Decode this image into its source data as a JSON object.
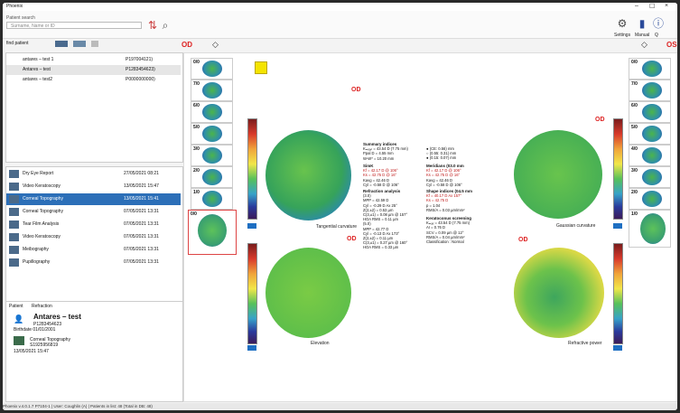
{
  "window": {
    "title": "Phoenix",
    "minimize": "–",
    "maximize": "☐",
    "close": "×"
  },
  "search": {
    "label": "Patient search",
    "placeholder": "Surname, Name or ID"
  },
  "toolbar_right": {
    "settings": "Settings",
    "manual": "Manual",
    "overflow": "Q"
  },
  "toolbar_left": {
    "find_patient": "find patient"
  },
  "patients": [
    {
      "name": "antares – test 1",
      "id": "P197004121)"
    },
    {
      "name": "Antares – test",
      "id": "P1283454623)"
    },
    {
      "name": "antares – test2",
      "id": "P0000000000)"
    }
  ],
  "exams": [
    {
      "name": "Dry Eye Report",
      "date": "27/05/2021 08:21"
    },
    {
      "name": "Video Keratoscopy",
      "date": "13/05/2021 15:47"
    },
    {
      "name": "Corneal Topography",
      "date": "13/05/2021 15:41"
    },
    {
      "name": "Corneal Topography",
      "date": "07/05/2021 13:31"
    },
    {
      "name": "Tear Film Analysis",
      "date": "07/05/2021 13:31"
    },
    {
      "name": "Video Keratoscopy",
      "date": "07/05/2021 13:31"
    },
    {
      "name": "Meibography",
      "date": "07/05/2021 13:31"
    },
    {
      "name": "Pupillography",
      "date": "07/05/2021 13:31"
    }
  ],
  "patient_tabs": {
    "patient": "Patient",
    "refraction": "Refraction"
  },
  "patient_info": {
    "name": "Antares – test",
    "id": "P1283454623",
    "birthdate": "Birthdate 01/01/2001",
    "exam_title": "Corneal Topography",
    "exam_id": "S1925956819",
    "exam_date": "13/05/2021 15:47"
  },
  "eye": {
    "left": "OD",
    "right": "OS"
  },
  "thumbs_left": [
    "0/0",
    "7/0",
    "6/0",
    "5/0",
    "3/0",
    "2/0",
    "1/0",
    "0/0"
  ],
  "thumbs_right": [
    "0/0",
    "7/0",
    "6/0",
    "5/0",
    "4/0",
    "3/0",
    "2/0",
    "1/0"
  ],
  "maps": {
    "tangential": "Tangential curvature",
    "gaussian": "Gaussian curvature",
    "elevation": "Elevation",
    "refractive": "Refractive power"
  },
  "summary": {
    "title": "Summary indices",
    "l1": "Kₘₑₐₙ = 43.54 D (7.75 mm)",
    "l2": "Ppal D = 4.55 mm",
    "l3": "W-W* = 10.20 mm",
    "r1": "● (CE: 0.56) mm",
    "r2": "○ (0.55: 0.31) mm",
    "r3": "● (0.15: 0.07) mm"
  },
  "simk": {
    "title": "SimK",
    "l1": "Kf = 42.17 D @ 106°",
    "l2": "Ks = 42.75 D @ 16°",
    "l3": "Kavg = 42.46 D",
    "l4": "Cyl = -0.58 D @ 106°"
  },
  "meridians": {
    "title": "Meridians (03.0 mm",
    "l1": "Kf = 42.17 D @ 106°",
    "l2": "Ks = 42.75 D @ 16°",
    "l3": "Kavg = 42.46 D",
    "l4": "Cyl = -0.58 D @ 106°"
  },
  "refraction": {
    "title": "Refraction analysis",
    "s1": "(3.0)",
    "l1": "MPP = 42.59 D",
    "l2": "Cyl = -0.29 D Ax 25°",
    "l3": "Z(2,±2) = 0.53 µm",
    "l4": "C(3,±1) = 0.08 µm @ 157°",
    "l5": "HOA RMS = 0.11 µm",
    "s2": "(5.0)",
    "m1": "MPP = 42.77 D",
    "m2": "Cyl = -0.13 D Ax 173°",
    "m3": "Z(2,±2) = 0.11 µm",
    "m4": "C(3,±1) = 0.27 µm @ 160°",
    "m5": "HOA RMS = 0.33 µm"
  },
  "shape": {
    "title": "Shape indices (04.5 mm",
    "l1": "Kf = 40.17 D Ax 157°",
    "l2": "Ks = 42.75 D",
    "l3": "p = 1.04",
    "l4": "RMS/A = 0.03 µm/mm²"
  },
  "keratoconus": {
    "title": "Keratoconus screening",
    "l1": "Kₘₐₓ = 43.54 D (7.75 mm)",
    "l2": "AI = 0.76 D",
    "l3": "SCV = 0.09 µm @ 12°",
    "l4": "RMS/A = 0.04 µm/mm²",
    "l5": "Classification : Normal"
  },
  "statusbar": "Phoenix v.4.0.1.7 P7104-1 | User: Coughlin (A) | Patients in list: 48 (Total in DB: 48)",
  "colors": {
    "accent": "#2c6fb8",
    "eye_red": "#d22222"
  }
}
